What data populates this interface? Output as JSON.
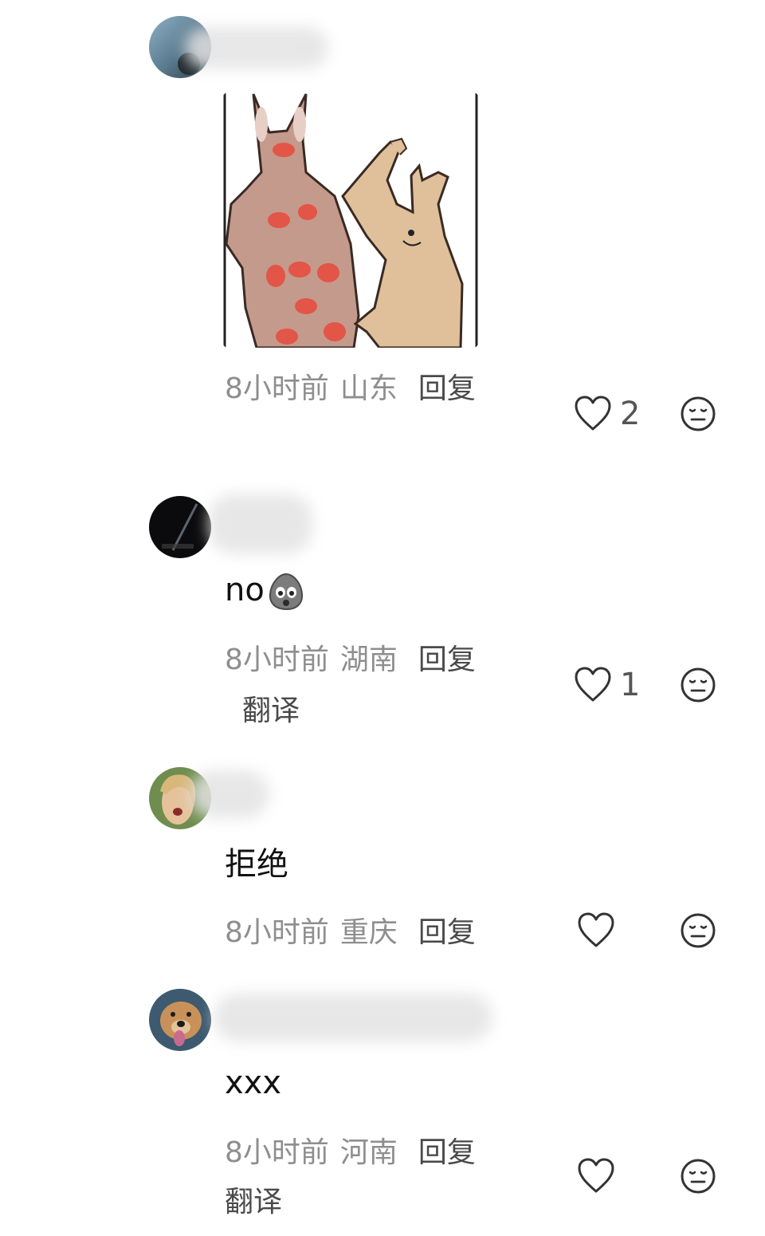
{
  "comments": [
    {
      "text": "",
      "time": "8小时前",
      "location": "山东",
      "reply_label": "回复",
      "likes": "2",
      "has_image": true
    },
    {
      "text": "no",
      "time": "8小时前",
      "location": "湖南",
      "reply_label": "回复",
      "translate_label": "翻译",
      "likes": "1",
      "emoji_icon": "shocked-bean-emoji"
    },
    {
      "text": "拒绝",
      "time": "8小时前",
      "location": "重庆",
      "reply_label": "回复",
      "likes": ""
    },
    {
      "text": "xxx",
      "time": "8小时前",
      "location": "河南",
      "reply_label": "回复",
      "translate_label": "翻译",
      "likes": ""
    }
  ],
  "icons": {
    "like": "heart-outline-icon",
    "dislike": "meh-face-icon"
  },
  "colors": {
    "meta_text": "#8e8e8e",
    "reply_text": "#4a4a4a",
    "icon_stroke": "#333333"
  }
}
